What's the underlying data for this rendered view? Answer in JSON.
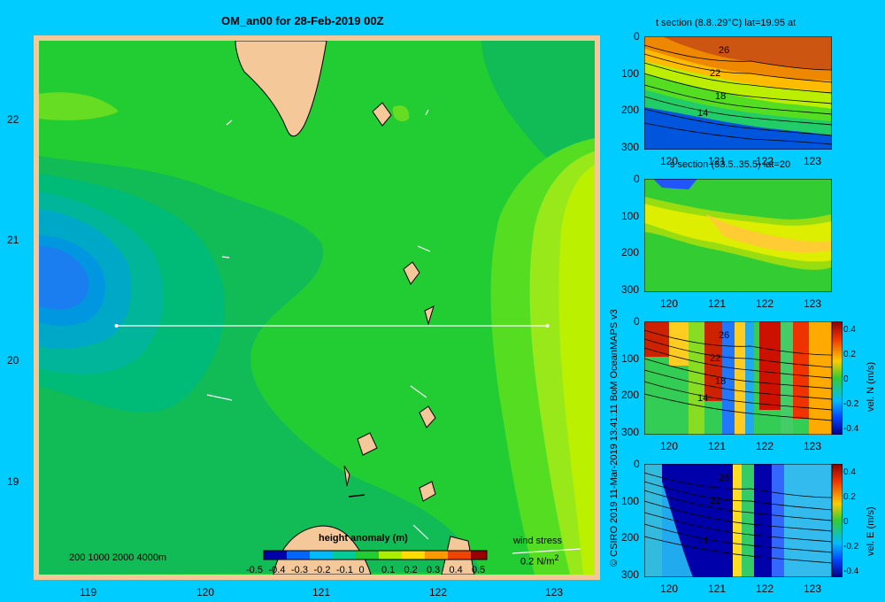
{
  "map": {
    "title": "OM_an00 for 28-Feb-2019 00Z",
    "lon_ticks": [
      "119",
      "120",
      "121",
      "122",
      "123"
    ],
    "lat_ticks": [
      "22",
      "21",
      "20",
      "19"
    ],
    "depth_legend": "200  1000  2000  4000m",
    "colorbar_title": "height anomaly (m)",
    "colorbar_ticks": [
      "-0.5",
      "-0.4",
      "-0.3",
      "-0.2",
      "-0.1",
      "0",
      "0.1",
      "0.2",
      "0.3",
      "0.4",
      "0.5"
    ],
    "wind_label": "wind stress",
    "wind_scale": "0.2 N/m",
    "wind_scale_exp": "2",
    "section_lat": 20,
    "section_lon_range": [
      119.5,
      123.2
    ]
  },
  "panels": {
    "t_title": "t section (8.8..29°C) lat=19.95 at",
    "s_title": "s section (33.5..35.5) lat=20",
    "depth_ticks": [
      "0",
      "100",
      "200",
      "300"
    ],
    "lon_ticks": [
      "120",
      "121",
      "122",
      "123"
    ],
    "t_contours": [
      "26",
      "22",
      "18",
      "14"
    ],
    "v_colorbar_ticks": [
      "0.4",
      "0.2",
      "0",
      "-0.2",
      "-0.4"
    ],
    "vn_label": "vel. N (m/s)",
    "ve_label": "vel. E (m/s)"
  },
  "credit": "© CSIRO 2019  11-Mar-2019 13:41:11 BoM OceanMAPS v3",
  "colors": {
    "background": "#00ccff",
    "land": "#f5c89a",
    "base_green": "#22cc33"
  }
}
